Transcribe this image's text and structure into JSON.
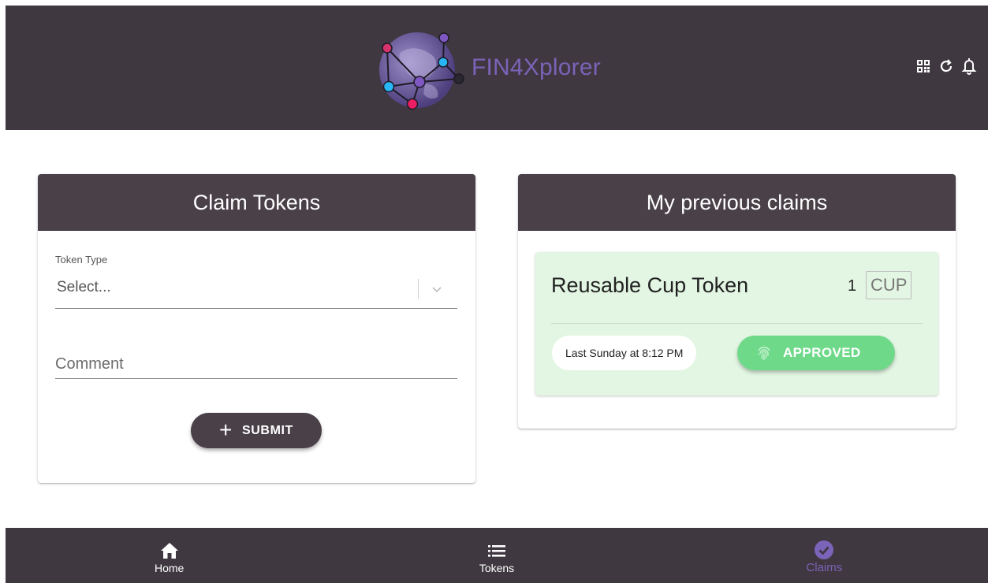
{
  "header": {
    "app_name": "FIN4Xplorer",
    "icons": [
      "qr-code-icon",
      "refresh-icon",
      "bell-icon"
    ]
  },
  "claim_tokens": {
    "title": "Claim Tokens",
    "token_type_label": "Token Type",
    "token_type_placeholder": "Select...",
    "comment_placeholder": "Comment",
    "submit_label": "SUBMIT"
  },
  "previous_claims": {
    "title": "My previous claims",
    "items": [
      {
        "token_name": "Reusable Cup Token",
        "amount": "1",
        "unit": "CUP",
        "date": "Last Sunday at 8:12 PM",
        "status": "APPROVED"
      }
    ]
  },
  "bottom_nav": {
    "items": [
      {
        "label": "Home",
        "icon": "home-icon"
      },
      {
        "label": "Tokens",
        "icon": "list-icon"
      },
      {
        "label": "Claims",
        "icon": "check-circle-icon",
        "active": true
      }
    ]
  },
  "colors": {
    "header_bg": "#3f3840",
    "card_header_bg": "#4a4148",
    "accent": "#7a63b8",
    "approved": "#6fd98a",
    "claim_bg": "#e3f6e3"
  }
}
